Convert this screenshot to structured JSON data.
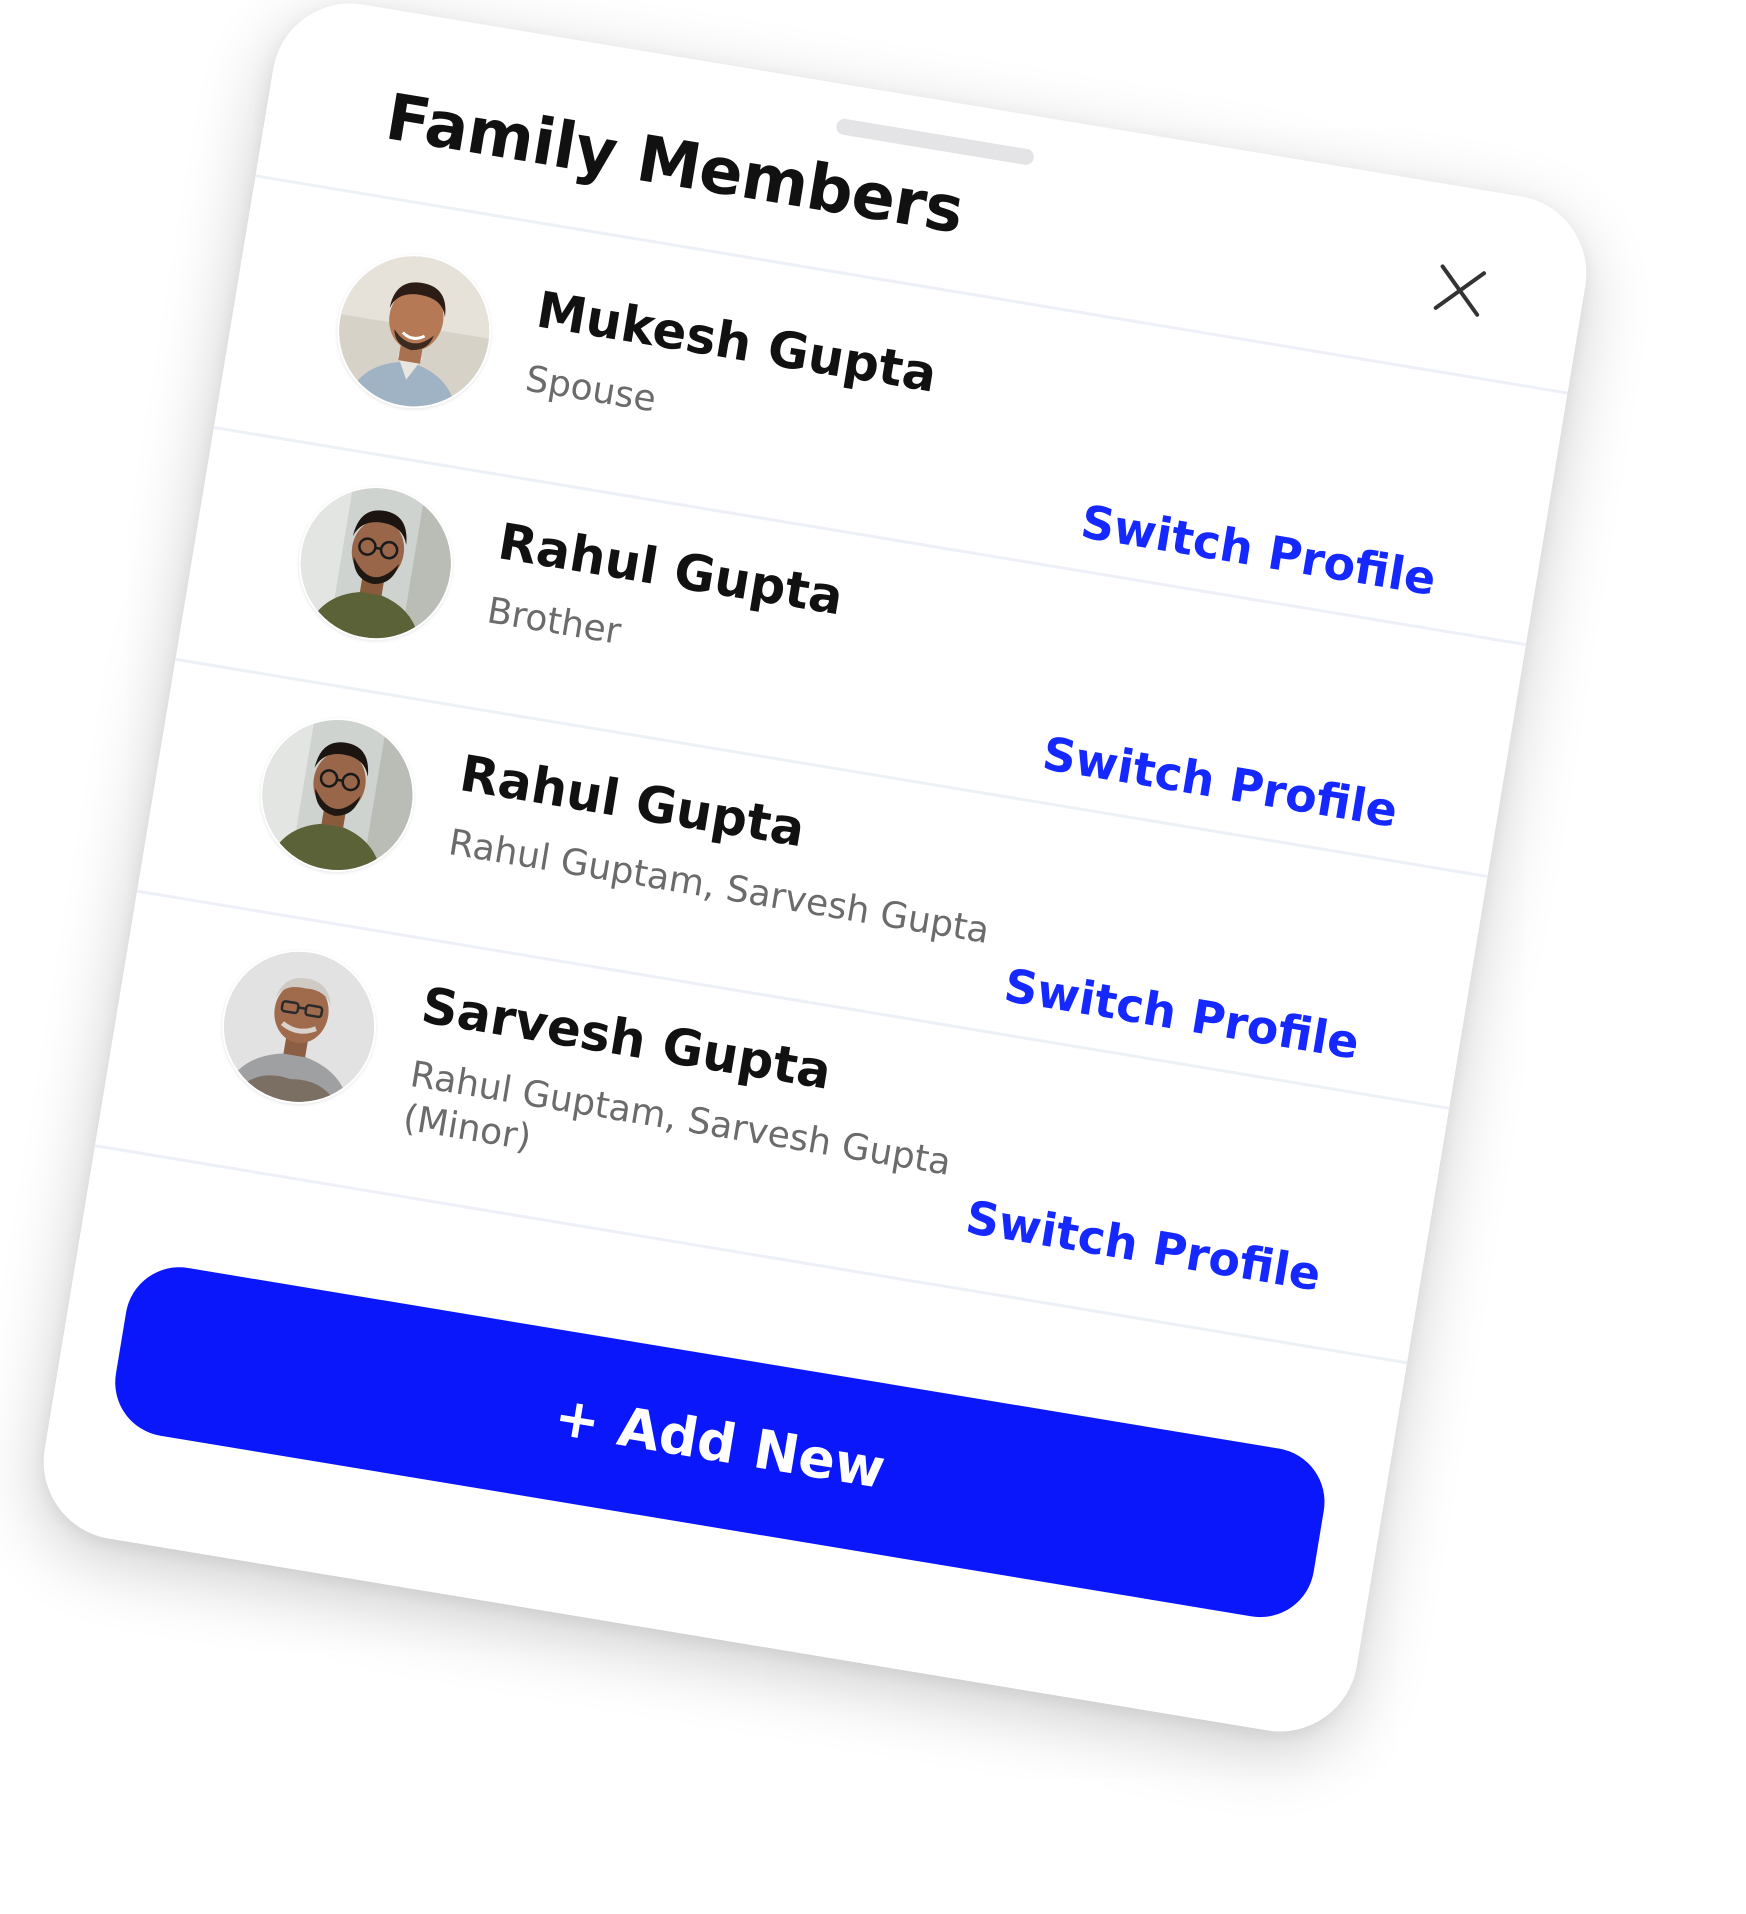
{
  "sheet": {
    "title": "Family Members",
    "add_button_label": "+ Add New"
  },
  "members": [
    {
      "name": "Mukesh Gupta",
      "relation": "Spouse",
      "action": "Switch Profile"
    },
    {
      "name": "Rahul Gupta",
      "relation": "Brother",
      "action": "Switch Profile"
    },
    {
      "name": "Rahul Gupta",
      "relation": "Rahul Guptam, Sarvesh Gupta",
      "action": "Switch Profile"
    },
    {
      "name": "Sarvesh Gupta",
      "relation": "Rahul Guptam, Sarvesh Gupta (Minor)",
      "action": "Switch Profile"
    }
  ],
  "colors": {
    "accent": "#0a17fb",
    "link": "#1428ff",
    "divider": "#eef0f8"
  },
  "icons": {
    "close": "close-icon",
    "drag_handle": "drag-handle"
  }
}
